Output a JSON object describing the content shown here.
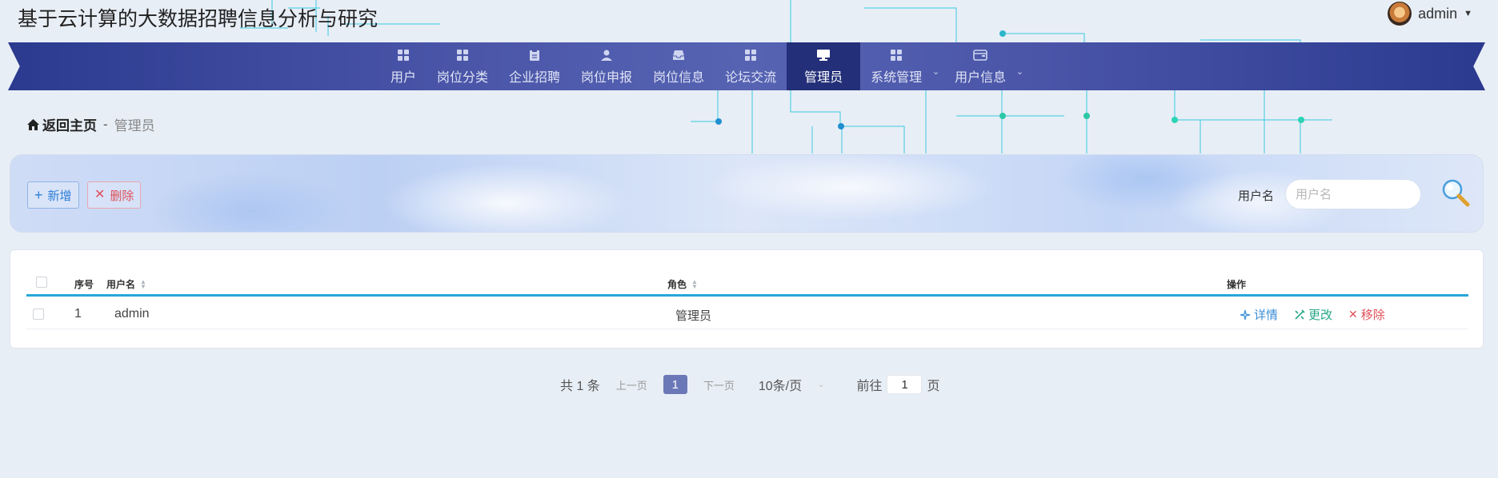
{
  "header": {
    "site_title": "基于云计算的大数据招聘信息分析与研究",
    "user_name": "admin"
  },
  "nav": {
    "items": [
      {
        "label": "用户",
        "icon": "grid-icon"
      },
      {
        "label": "岗位分类",
        "icon": "grid-icon"
      },
      {
        "label": "企业招聘",
        "icon": "clipboard-icon"
      },
      {
        "label": "岗位申报",
        "icon": "user-icon"
      },
      {
        "label": "岗位信息",
        "icon": "tray-icon"
      },
      {
        "label": "论坛交流",
        "icon": "grid-icon"
      },
      {
        "label": "管理员",
        "icon": "monitor-icon",
        "active": true
      },
      {
        "label": "系统管理",
        "icon": "grid-icon",
        "has_submenu": true
      },
      {
        "label": "用户信息",
        "icon": "wallet-icon",
        "has_submenu": true
      }
    ]
  },
  "breadcrumb": {
    "home": "返回主页",
    "separator": "-",
    "current": "管理员"
  },
  "toolbar": {
    "add_label": "新增",
    "delete_label": "删除",
    "search_label": "用户名",
    "search_placeholder": "用户名"
  },
  "table": {
    "headers": {
      "index": "序号",
      "username": "用户名",
      "role": "角色",
      "actions": "操作"
    },
    "rows": [
      {
        "index": "1",
        "username": "admin",
        "role": "管理员"
      }
    ],
    "actions": {
      "detail": "详情",
      "edit": "更改",
      "remove": "移除"
    }
  },
  "pagination": {
    "total": "共 1 条",
    "prev": "上一页",
    "current_page": "1",
    "next": "下一页",
    "page_size": "10条/页",
    "goto_prefix": "前往",
    "goto_value": "1",
    "goto_suffix": "页"
  },
  "colors": {
    "nav_bg": "#3b4a9e",
    "nav_active": "#232f78",
    "accent_blue": "#27a7d8",
    "danger": "#e0505a",
    "success": "#2aa889"
  }
}
